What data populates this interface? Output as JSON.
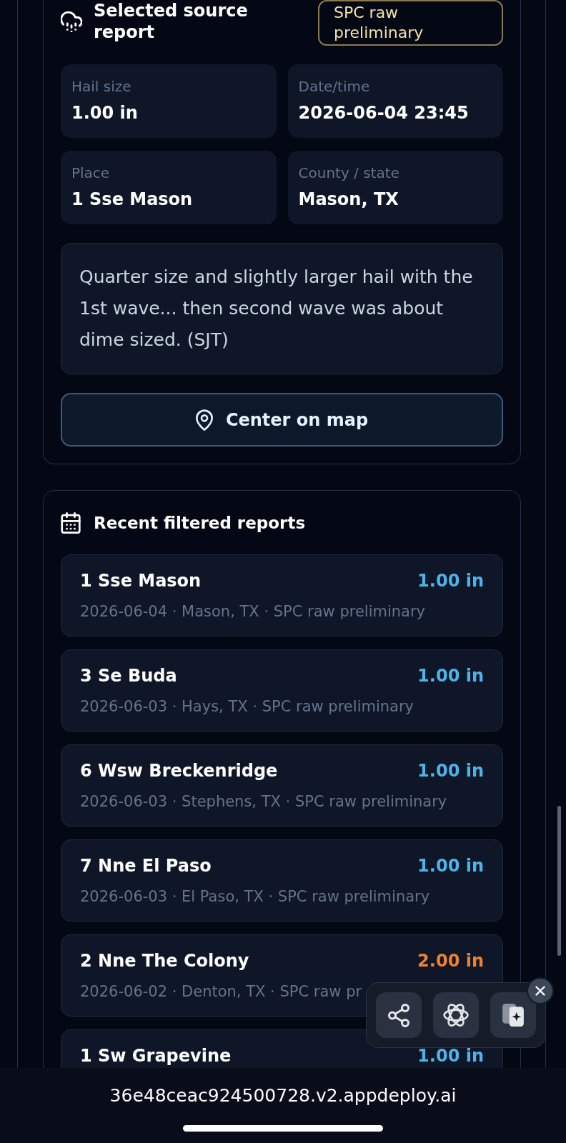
{
  "source_report": {
    "title": "Selected source report",
    "badge": "SPC raw preliminary",
    "fields": [
      {
        "label": "Hail size",
        "value": "1.00 in"
      },
      {
        "label": "Date/time",
        "value": "2026-06-04 23:45"
      },
      {
        "label": "Place",
        "value": "1 Sse Mason"
      },
      {
        "label": "County / state",
        "value": "Mason, TX"
      }
    ],
    "note": "Quarter size and slightly larger hail with the 1st wave... then second wave was about dime sized. (SJT)",
    "button": "Center on map"
  },
  "recent_reports": {
    "title": "Recent filtered reports",
    "items": [
      {
        "place": "1 Sse Mason",
        "size": "1.00 in",
        "color": "#4fb3ea",
        "meta": "2026-06-04 · Mason, TX · SPC raw preliminary"
      },
      {
        "place": "3 Se Buda",
        "size": "1.00 in",
        "color": "#4fb3ea",
        "meta": "2026-06-03 · Hays, TX · SPC raw preliminary"
      },
      {
        "place": "6 Wsw Breckenridge",
        "size": "1.00 in",
        "color": "#4fb3ea",
        "meta": "2026-06-03 · Stephens, TX · SPC raw preliminary"
      },
      {
        "place": "7 Nne El Paso",
        "size": "1.00 in",
        "color": "#4fb3ea",
        "meta": "2026-06-03 · El Paso, TX · SPC raw preliminary"
      },
      {
        "place": "2 Nne The Colony",
        "size": "2.00 in",
        "color": "#f0812e",
        "meta": "2026-06-02 · Denton, TX · SPC raw pr"
      },
      {
        "place": "1 Sw Grapevine",
        "size": "1.00 in",
        "color": "#4fb3ea"
      }
    ]
  },
  "browser_bar": {
    "url": "36e48ceac924500728.v2.appdeploy.ai"
  }
}
